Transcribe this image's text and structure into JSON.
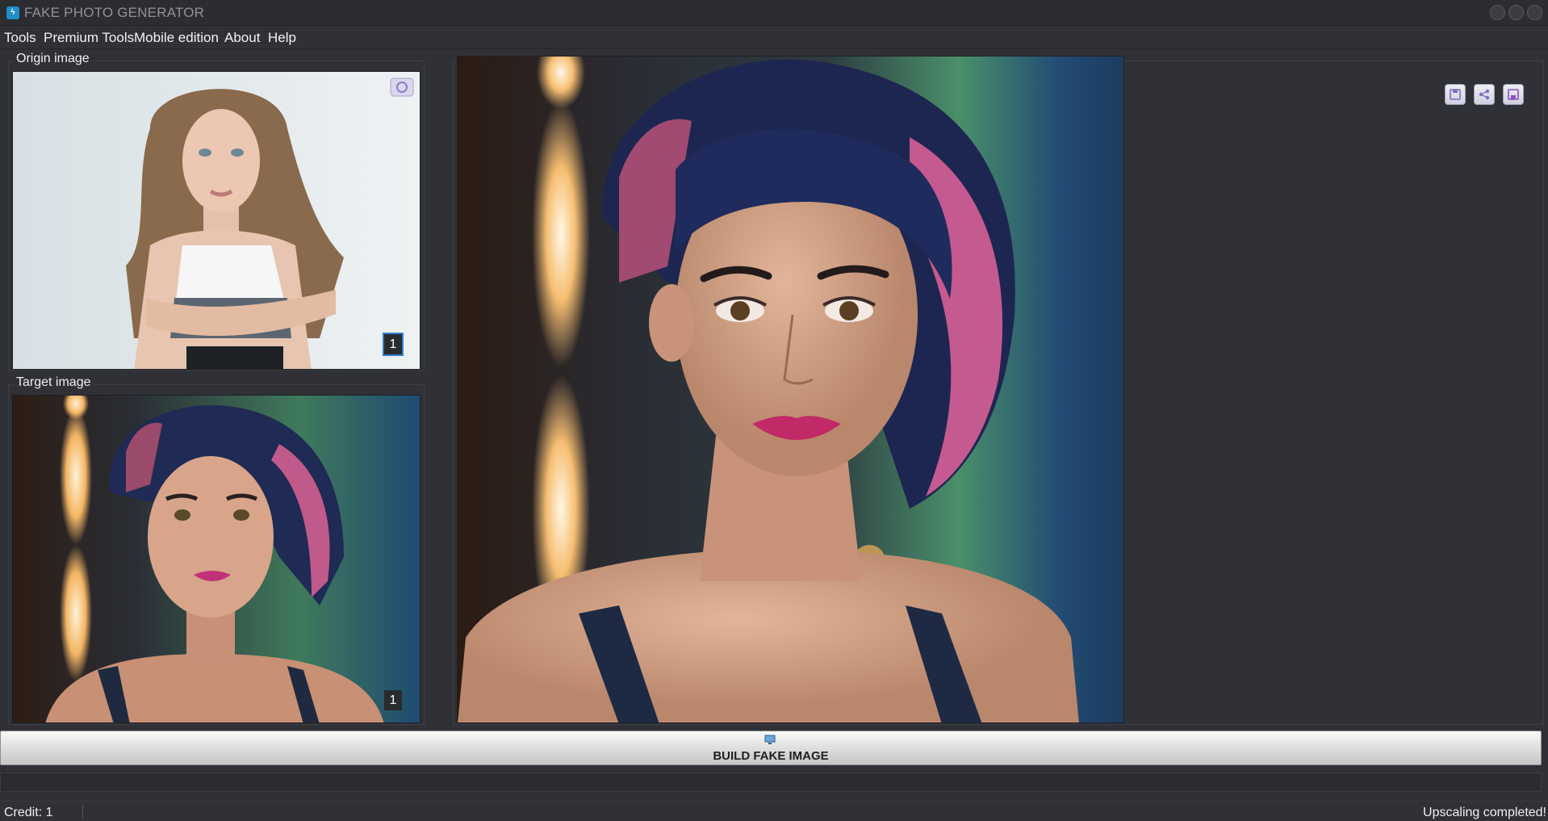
{
  "window": {
    "title": "FAKE PHOTO GENERATOR",
    "icon": "app-logo-icon"
  },
  "menu": {
    "items": [
      {
        "label": "Tools"
      },
      {
        "label": "Premium Tools"
      },
      {
        "label": "Mobile edition"
      },
      {
        "label": "About"
      },
      {
        "label": "Help"
      }
    ]
  },
  "origin": {
    "label": "Origin image",
    "count": "1",
    "camera_icon": "camera-icon"
  },
  "target": {
    "label": "Target image",
    "count": "1"
  },
  "output": {
    "tools": [
      "save-icon",
      "share-icon",
      "save-as-icon"
    ]
  },
  "build": {
    "label": "BUILD FAKE IMAGE",
    "icon": "monitor-icon"
  },
  "status": {
    "credit": "Credit: 1",
    "message": "Upscaling completed!"
  },
  "colors": {
    "background": "#2f3137",
    "accent": "#1f8fc9",
    "tool_button": "#d6d6e6"
  }
}
